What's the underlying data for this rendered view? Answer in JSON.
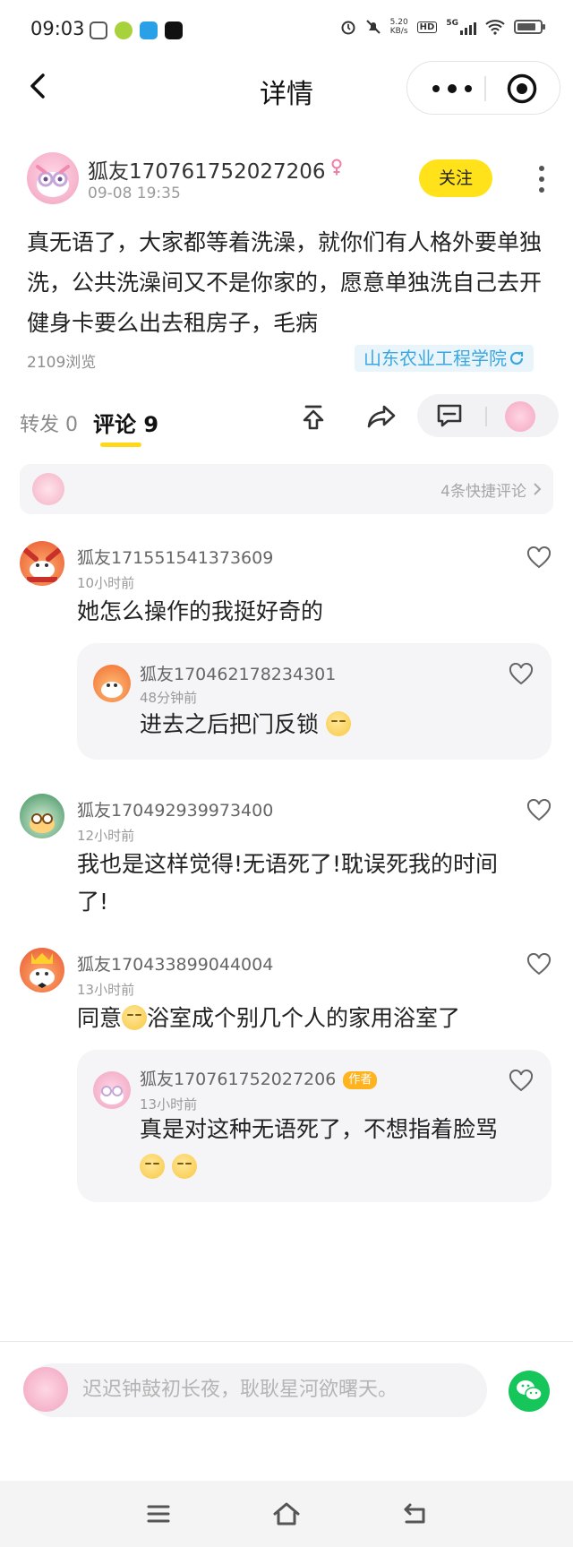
{
  "status_bar": {
    "time": "09:03",
    "net_speed_value": "5.20",
    "net_speed_unit": "KB/s",
    "hd": "HD",
    "network": "5G"
  },
  "nav": {
    "title": "详情"
  },
  "post": {
    "author_name": "狐友170761752027206",
    "time": "09-08 19:35",
    "follow_label": "关注",
    "content": "真无语了，大家都等着洗澡，就你们有人格外要单独洗，公共洗澡间又不是你家的，愿意单独洗自己去开健身卡要么出去租房子，毛病",
    "views": "2109浏览",
    "school": "山东农业工程学院"
  },
  "tabs": {
    "forward": "转发 0",
    "comment": "评论 9"
  },
  "quick_comments": {
    "label": "4条快捷评论"
  },
  "comments": [
    {
      "name": "狐友171551541373609",
      "time": "10小时前",
      "text": "她怎么操作的我挺好奇的",
      "reply": {
        "name": "狐友170462178234301",
        "time": "48分钟前",
        "text": "进去之后把门反锁"
      }
    },
    {
      "name": "狐友170492939973400",
      "time": "12小时前",
      "text_line1": "我也是这样觉得!无语死了!耽误死我的时间",
      "text_line2": "了!"
    },
    {
      "name": "狐友170433899044004",
      "time": "13小时前",
      "text_before": "同意",
      "text_after": "浴室成个别几个人的家用浴室了",
      "reply": {
        "name": "狐友170761752027206",
        "badge": "作者",
        "time": "13小时前",
        "text": "真是对这种无语死了，不想指着脸骂"
      }
    }
  ],
  "input": {
    "placeholder": "迟迟钟鼓初长夜，耿耿星河欲曙天。"
  },
  "colors": {
    "accent_yellow": "#ffe219",
    "link_blue": "#3aa7e0",
    "wechat_green": "#17c65b",
    "author_badge": "#ffb31f"
  }
}
